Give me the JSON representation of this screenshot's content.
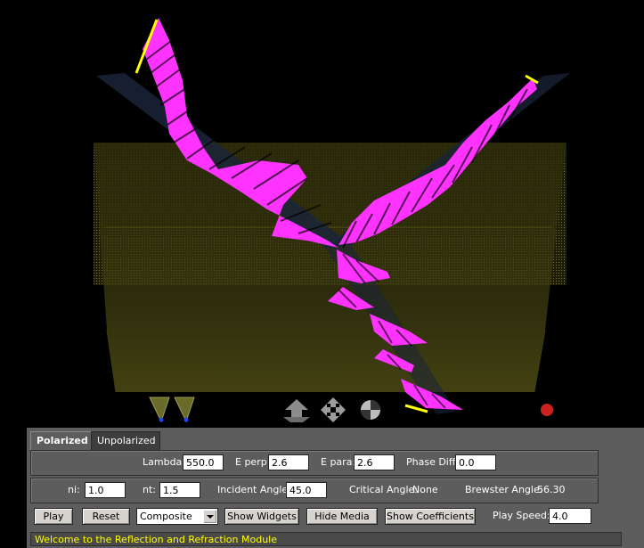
{
  "colors": {
    "background": "#000000",
    "wave": "#ff33ff",
    "medium": "#6b6a1c",
    "beam": "#1a2438",
    "marker": "#ffff00",
    "panel": "#5d5d5d",
    "status_text": "#ffff00",
    "red_dot": "#cc2222"
  },
  "scene": {
    "icons": [
      "polarizer-left-icon",
      "polarizer-right-icon",
      "translate-icon",
      "move-arrows-icon",
      "rotate-sphere-icon",
      "red-dot-icon"
    ]
  },
  "tabs": [
    {
      "label": "Polarized",
      "active": true
    },
    {
      "label": "Unpolarized",
      "active": false
    }
  ],
  "wave": {
    "lambda_label": "Lambda:",
    "lambda_value": "550.0",
    "eperp_label": "E perp:",
    "eperp_value": "2.6",
    "epara_label": "E para:",
    "epara_value": "2.6",
    "phase_label": "Phase Diff:",
    "phase_value": "0.0"
  },
  "media": {
    "ni_label": "ni:",
    "ni_value": "1.0",
    "nt_label": "nt:",
    "nt_value": "1.5",
    "incident_label": "Incident Angle:",
    "incident_value": "45.0",
    "critical_label": "Critical Angle:",
    "critical_value": "None",
    "brewster_label": "Brewster Angle:",
    "brewster_value": "56.30"
  },
  "controls": {
    "play": "Play",
    "reset": "Reset",
    "mode": "Composite",
    "show_widgets": "Show Widgets",
    "hide_media": "Hide Media",
    "show_coefficients": "Show Coefficients",
    "speed_label": "Play Speed:",
    "speed_value": "4.0"
  },
  "status": "Welcome to the Reflection and Refraction Module"
}
